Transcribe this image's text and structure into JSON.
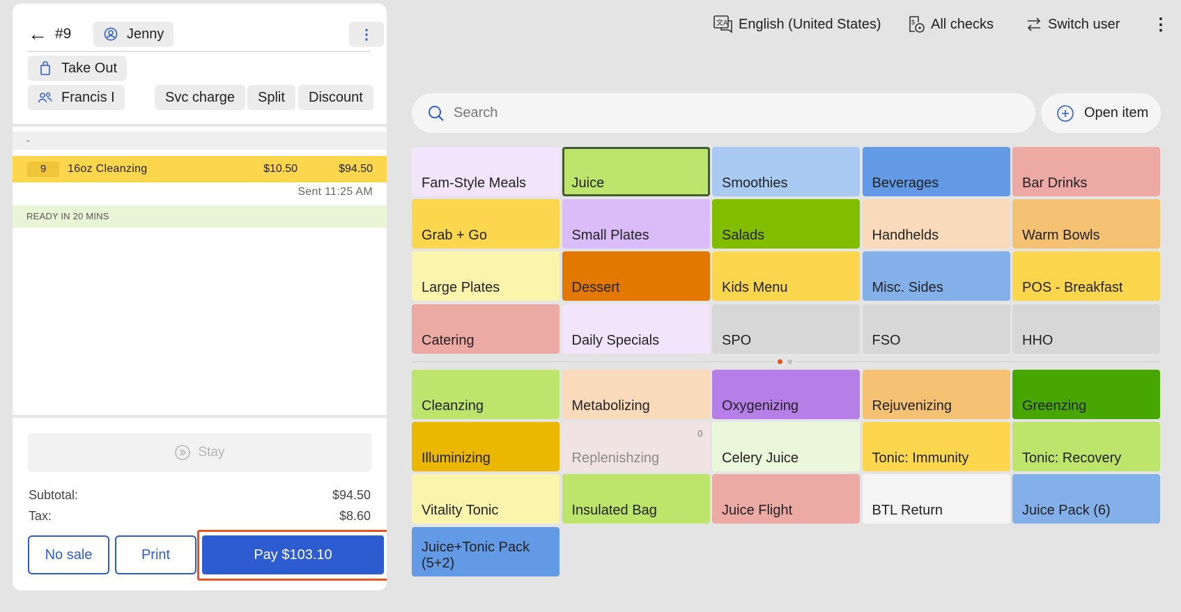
{
  "order": {
    "check_number": "#9",
    "server": "Jenny",
    "dining_option": "Take Out",
    "guest": "Francis I",
    "actions": [
      "Svc charge",
      "Split",
      "Discount"
    ],
    "seat_label": "-",
    "items": [
      {
        "qty": "9",
        "name": "16oz Cleanzing",
        "unit_price": "$10.50",
        "total": "$94.50"
      }
    ],
    "sent_label": "Sent 11:25 AM",
    "ready_label": "READY IN 20 MINS",
    "stay_label": "Stay",
    "subtotal_label": "Subtotal:",
    "subtotal_value": "$94.50",
    "tax_label": "Tax:",
    "tax_value": "$8.60",
    "no_sale_label": "No sale",
    "print_label": "Print",
    "pay_label": "Pay $103.10"
  },
  "topbar": {
    "language": "English (United States)",
    "all_checks": "All checks",
    "switch_user": "Switch user"
  },
  "search": {
    "placeholder": "Search",
    "open_item_label": "Open item"
  },
  "menu_groups": [
    {
      "label": "Fam-Style Meals",
      "color": "#f1e4fb"
    },
    {
      "label": "Juice",
      "color": "#bde46b",
      "selected": true
    },
    {
      "label": "Smoothies",
      "color": "#a9cbf3"
    },
    {
      "label": "Beverages",
      "color": "#629ae6"
    },
    {
      "label": "Bar Drinks",
      "color": "#eda9a4"
    },
    {
      "label": "Grab + Go",
      "color": "#fcd64d"
    },
    {
      "label": "Small Plates",
      "color": "#dabcf8"
    },
    {
      "label": "Salads",
      "color": "#83bd00"
    },
    {
      "label": "Handhelds",
      "color": "#f9dabb"
    },
    {
      "label": "Warm Bowls",
      "color": "#f5c173"
    },
    {
      "label": "Large Plates",
      "color": "#fbf4ad"
    },
    {
      "label": "Dessert",
      "color": "#e37800"
    },
    {
      "label": "Kids Menu",
      "color": "#fcd64d"
    },
    {
      "label": "Misc. Sides",
      "color": "#84b0ea"
    },
    {
      "label": "POS - Breakfast",
      "color": "#fcd64d"
    },
    {
      "label": "Catering",
      "color": "#eda9a4"
    },
    {
      "label": "Daily Specials",
      "color": "#f1e4fb"
    },
    {
      "label": "SPO",
      "color": "#d7d7d7"
    },
    {
      "label": "FSO",
      "color": "#d7d7d7"
    },
    {
      "label": "HHO",
      "color": "#d7d7d7"
    }
  ],
  "menu_items": [
    {
      "label": "Cleanzing",
      "color": "#bde46b"
    },
    {
      "label": "Metabolizing",
      "color": "#f9dabb"
    },
    {
      "label": "Oxygenizing",
      "color": "#b67fe8"
    },
    {
      "label": "Rejuvenizing",
      "color": "#f5c173"
    },
    {
      "label": "Greenzing",
      "color": "#47a700"
    },
    {
      "label": "Illuminizing",
      "color": "#ebb700"
    },
    {
      "label": "Replenishzing",
      "color": "#f1e3e3",
      "badge": "0",
      "dim": true
    },
    {
      "label": "Celery Juice",
      "color": "#ebf7da"
    },
    {
      "label": "Tonic: Immunity",
      "color": "#fcd64d"
    },
    {
      "label": "Tonic: Recovery",
      "color": "#bde46b"
    },
    {
      "label": "Vitality Tonic",
      "color": "#fbf4ad"
    },
    {
      "label": "Insulated Bag",
      "color": "#bde46b"
    },
    {
      "label": "Juice Flight",
      "color": "#eda9a4"
    },
    {
      "label": "BTL Return",
      "color": "#f5f5f5"
    },
    {
      "label": "Juice Pack (6)",
      "color": "#84b0ea"
    },
    {
      "label": "Juice+Tonic Pack (5+2)",
      "color": "#629ae6"
    }
  ]
}
